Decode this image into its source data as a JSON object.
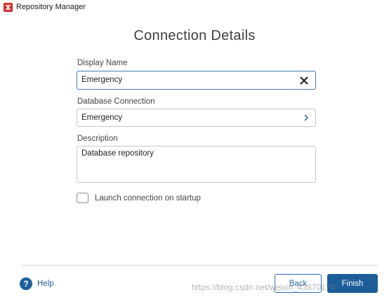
{
  "window": {
    "title": "Repository Manager"
  },
  "page": {
    "heading": "Connection Details"
  },
  "form": {
    "display_name": {
      "label": "Display Name",
      "value": "Emergency"
    },
    "database_connection": {
      "label": "Database Connection",
      "value": "Emergency"
    },
    "description": {
      "label": "Description",
      "value": "Database repository"
    },
    "launch_on_startup": {
      "label": "Launch connection on startup",
      "checked": false
    }
  },
  "footer": {
    "help_label": "Help",
    "back_label": "Back",
    "finish_label": "Finish"
  },
  "watermark": {
    "text": "https://blog.csdn.net/weixin_43870170"
  },
  "colors": {
    "accent": "#1c5d9a",
    "focus_border": "#4a79b5",
    "logo": "#d42b2b"
  },
  "icons": {
    "app": "repository-manager-logo-icon",
    "clear": "close-icon",
    "connection": "chevron-right-icon",
    "help": "help-icon"
  }
}
